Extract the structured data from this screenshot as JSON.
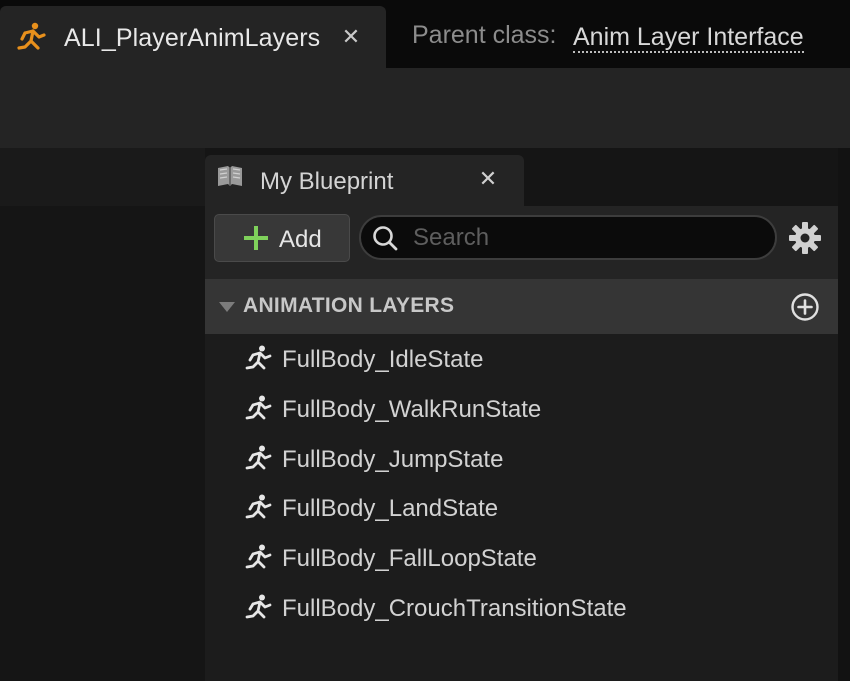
{
  "document_tab": {
    "title": "ALI_PlayerAnimLayers",
    "icon": "running-figure-icon",
    "icon_color": "#e8901c",
    "close_glyph": "✕"
  },
  "parent_class": {
    "label": "Parent class:",
    "value": "Anim Layer Interface"
  },
  "blueprint_panel": {
    "tab_title": "My Blueprint",
    "tab_icon": "book-icon",
    "close_glyph": "✕",
    "add_button_label": "Add",
    "add_icon_color": "#7fd15b",
    "search_placeholder": "Search",
    "search_value": ""
  },
  "category": {
    "title": "ANIMATION LAYERS",
    "expanded": true
  },
  "layers": [
    {
      "label": "FullBody_IdleState"
    },
    {
      "label": "FullBody_WalkRunState"
    },
    {
      "label": "FullBody_JumpState"
    },
    {
      "label": "FullBody_LandState"
    },
    {
      "label": "FullBody_FallLoopState"
    },
    {
      "label": "FullBody_CrouchTransitionState"
    }
  ]
}
